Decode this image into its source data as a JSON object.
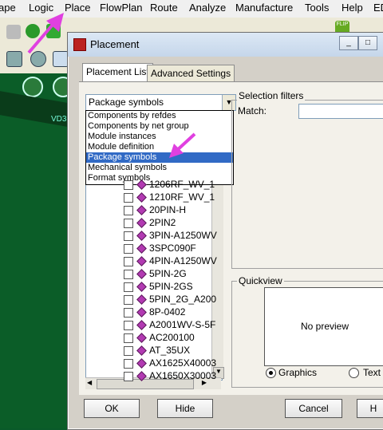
{
  "menubar": {
    "items": [
      {
        "label": "ape",
        "mnemonic": ""
      },
      {
        "label": "Logic",
        "mnemonic": "L"
      },
      {
        "label": "Place",
        "mnemonic": "P"
      },
      {
        "label": "FlowPlan",
        "mnemonic": "F"
      },
      {
        "label": "Route",
        "mnemonic": "R"
      },
      {
        "label": "Analyze",
        "mnemonic": "A"
      },
      {
        "label": "Manufacture",
        "mnemonic": "M"
      },
      {
        "label": "Tools",
        "mnemonic": "T"
      },
      {
        "label": "Help",
        "mnemonic": "H"
      },
      {
        "label": "ED",
        "mnemonic": ""
      }
    ]
  },
  "canvas": {
    "label": "VD3"
  },
  "dialog": {
    "title": "Placement",
    "tabs": [
      "Placement List",
      "Advanced Settings"
    ],
    "combo_value": "Package symbols",
    "dropdown_options": [
      "Components by refdes",
      "Components by net group",
      "Module instances",
      "Module definition",
      "Package symbols",
      "Mechanical symbols",
      "Format symbols"
    ],
    "selected_option": "Package symbols",
    "tree_rows": [
      "1206RF_WV_1",
      "1210RF_WV_1",
      "20PIN-H",
      "2PIN2",
      "3PIN-A1250WV",
      "3SPC090F",
      "4PIN-A1250WV",
      "5PIN-2G",
      "5PIN-2GS",
      "5PIN_2G_A200",
      "8P-0402",
      "A2001WV-S-5F",
      "AC200100",
      "AT_35UX",
      "AX1625X40003",
      "AX1650X30003"
    ],
    "selection_filters_label": "Selection filters",
    "match_label": "Match:",
    "quickview_label": "Quickview",
    "preview_text": "No preview",
    "radio_graphics": "Graphics",
    "radio_text": "Text",
    "buttons": {
      "ok": "OK",
      "hide": "Hide",
      "cancel": "Cancel",
      "help": "H"
    }
  },
  "colors": {
    "menu_underline": "#c00000",
    "selection": "#316ac5",
    "annotation_arrow": "#e040e0",
    "pcb_green": "#0b5d28"
  }
}
